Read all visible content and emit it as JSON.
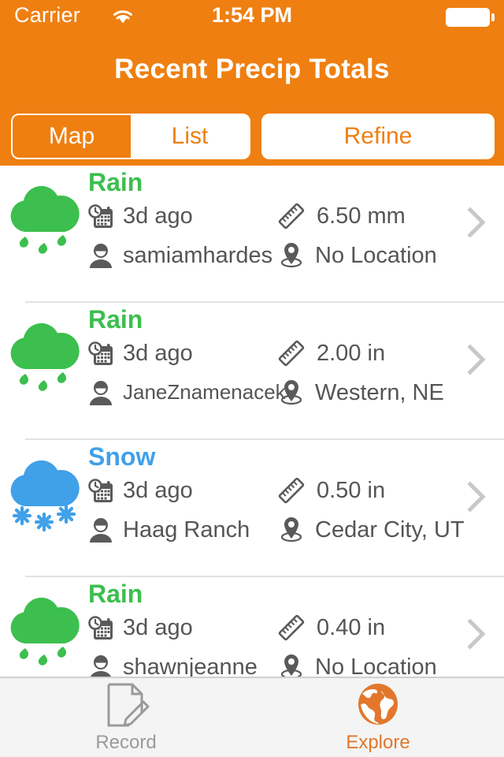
{
  "status_bar": {
    "carrier": "Carrier",
    "wifi_icon": "wifi-icon",
    "time": "1:54 PM",
    "battery_icon": "battery-full-icon"
  },
  "header": {
    "title": "Recent Precip Totals",
    "background_color": "#ef7f10",
    "segmented": {
      "options": [
        {
          "label": "Map",
          "selected": true
        },
        {
          "label": "List",
          "selected": false
        }
      ]
    },
    "refine_label": "Refine"
  },
  "colors": {
    "brand_orange": "#ef7f10",
    "rain_green": "#3cbf4e",
    "snow_blue": "#40a0e8",
    "meta_gray": "#555555",
    "chevron_gray": "#c8c8c8",
    "tab_inactive": "#9a9a9a",
    "tab_active": "#e2772c"
  },
  "list": {
    "rows": [
      {
        "type": "Rain",
        "icon": "rain-cloud-icon",
        "color": "#3cbf4e",
        "date": "3d ago",
        "amount": "6.50 mm",
        "user": "samiamhardes",
        "location": "No Location"
      },
      {
        "type": "Rain",
        "icon": "rain-cloud-icon",
        "color": "#3cbf4e",
        "date": "3d ago",
        "amount": "2.00 in",
        "user": "JaneZnamenacek",
        "location": "Western, NE"
      },
      {
        "type": "Snow",
        "icon": "snow-cloud-icon",
        "color": "#40a0e8",
        "date": "3d ago",
        "amount": "0.50 in",
        "user": "Haag Ranch",
        "location": "Cedar City, UT"
      },
      {
        "type": "Rain",
        "icon": "rain-cloud-icon",
        "color": "#3cbf4e",
        "date": "3d ago",
        "amount": "0.40 in",
        "user": "shawnjeanne",
        "location": "No Location"
      }
    ],
    "meta_icons": {
      "date": "calendar-clock-icon",
      "amount": "ruler-icon",
      "user": "person-icon",
      "location": "map-pin-icon",
      "disclosure": "chevron-right-icon"
    }
  },
  "tab_bar": {
    "tabs": [
      {
        "label": "Record",
        "icon": "document-pencil-icon",
        "active": false
      },
      {
        "label": "Explore",
        "icon": "globe-icon",
        "active": true
      }
    ]
  }
}
